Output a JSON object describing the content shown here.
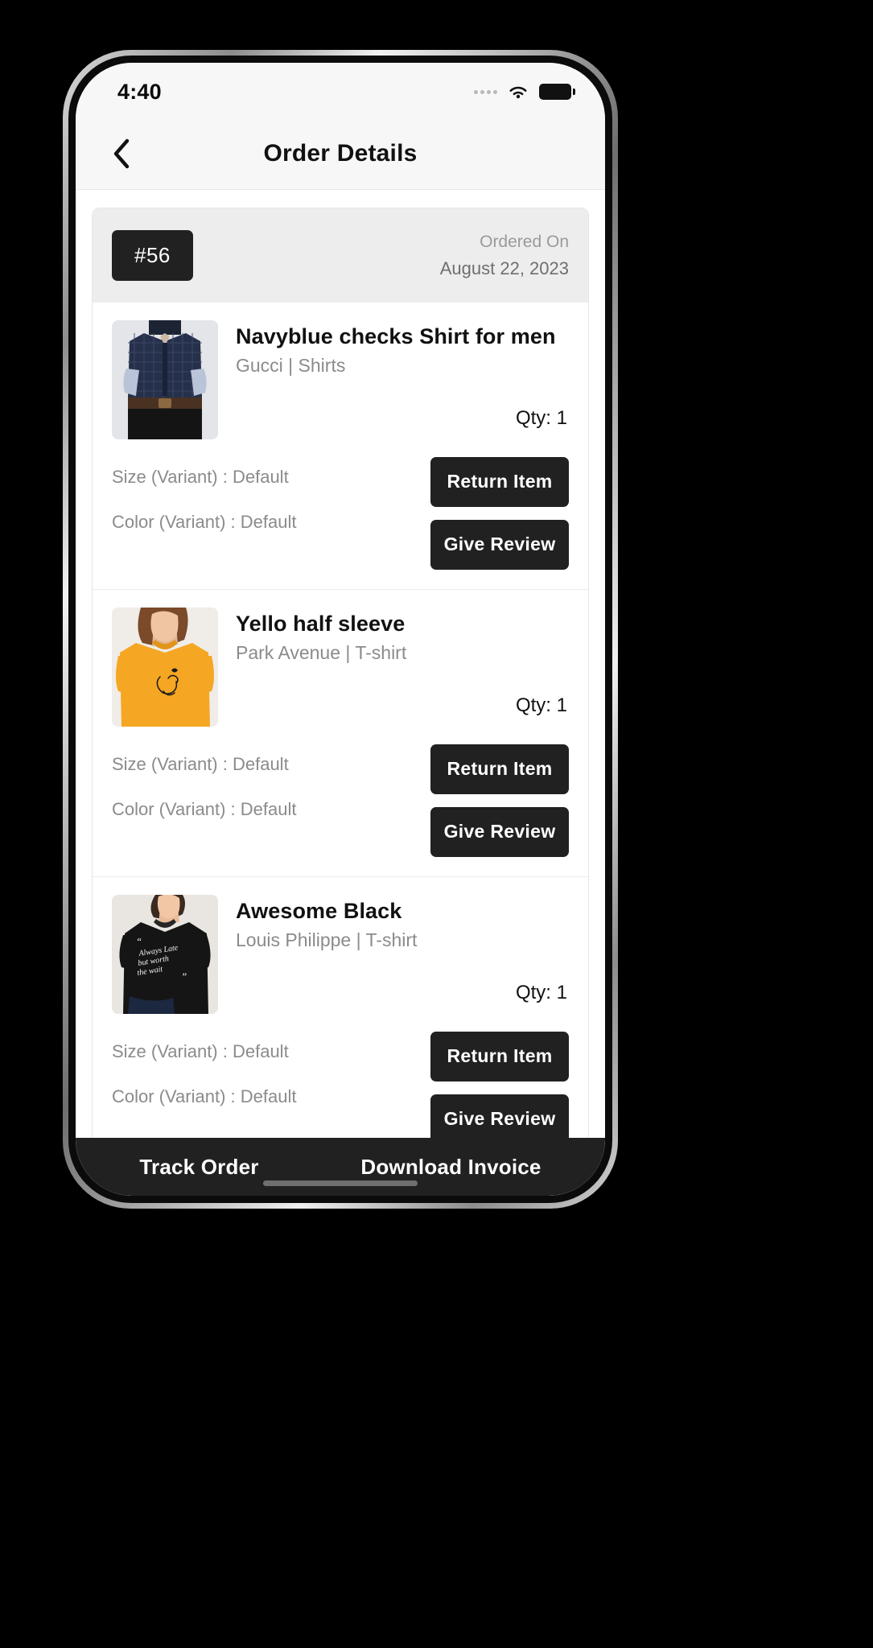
{
  "status_bar": {
    "time": "4:40",
    "icons": [
      "cellular-dots-icon",
      "wifi-icon",
      "battery-icon"
    ]
  },
  "app_bar": {
    "back_icon": "chevron-left-icon",
    "title": "Order Details"
  },
  "order": {
    "number_badge": "#56",
    "ordered_on_label": "Ordered On",
    "ordered_on_date": "August 22, 2023",
    "items": [
      {
        "title": "Navyblue checks Shirt for men",
        "brand_category": "Gucci | Shirts",
        "qty": "Qty: 1",
        "size_variant": "Size (Variant) : Default",
        "color_variant": "Color (Variant) : Default",
        "return_label": "Return Item",
        "review_label": "Give Review",
        "thumb": "navy-checked-shirt-photo"
      },
      {
        "title": "Yello half sleeve",
        "brand_category": "Park Avenue | T-shirt",
        "qty": "Qty: 1",
        "size_variant": "Size (Variant) : Default",
        "color_variant": "Color (Variant) : Default",
        "return_label": "Return Item",
        "review_label": "Give Review",
        "thumb": "yellow-tshirt-photo"
      },
      {
        "title": "Awesome Black",
        "brand_category": "Louis Philippe | T-shirt",
        "qty": "Qty: 1",
        "size_variant": "Size (Variant) : Default",
        "color_variant": "Color (Variant) : Default",
        "return_label": "Return Item",
        "review_label": "Give Review",
        "thumb": "black-tshirt-photo"
      }
    ]
  },
  "bottom_bar": {
    "track_label": "Track Order",
    "invoice_label": "Download Invoice"
  },
  "colors": {
    "dark": "#212121",
    "header_gray": "#ededed",
    "muted_text": "#8b8b8b",
    "accent_yellow": "#f5a623"
  }
}
